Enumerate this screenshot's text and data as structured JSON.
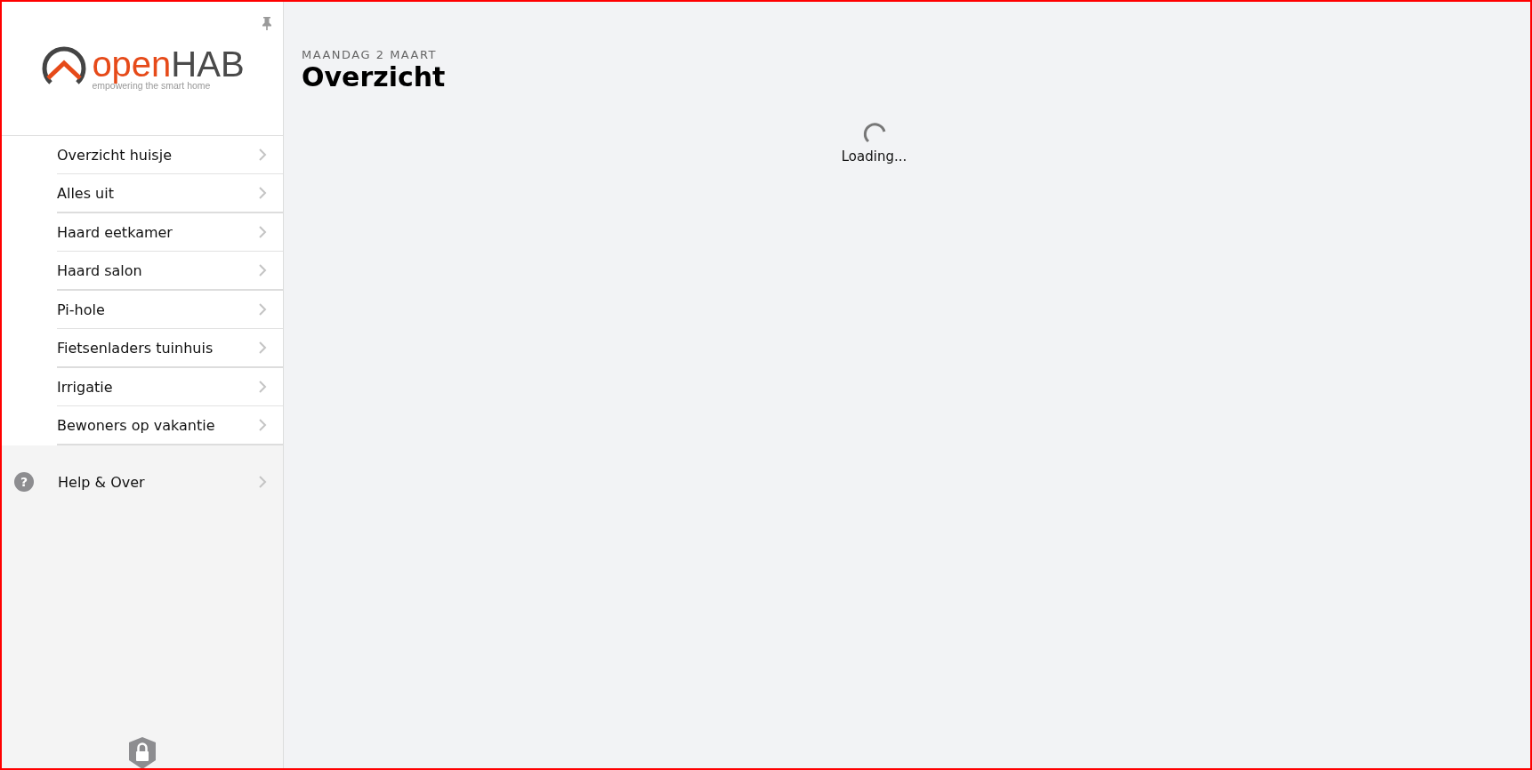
{
  "sidebar": {
    "logo": {
      "brand_first": "open",
      "brand_second": "HAB",
      "tagline": "empowering the smart home"
    },
    "groups": [
      {
        "items": [
          {
            "label": "Overzicht huisje"
          },
          {
            "label": "Alles uit"
          }
        ]
      },
      {
        "items": [
          {
            "label": "Haard eetkamer"
          },
          {
            "label": "Haard salon"
          }
        ]
      },
      {
        "items": [
          {
            "label": "Pi-hole"
          },
          {
            "label": "Fietsenladers tuinhuis"
          }
        ]
      },
      {
        "items": [
          {
            "label": "Irrigatie"
          },
          {
            "label": "Bewoners op vakantie"
          }
        ]
      }
    ],
    "help_item": {
      "icon_glyph": "?",
      "label": "Help & Over"
    }
  },
  "header": {
    "date": "MAANDAG 2 MAART",
    "title": "Overzicht"
  },
  "content": {
    "loading_text": "Loading..."
  }
}
